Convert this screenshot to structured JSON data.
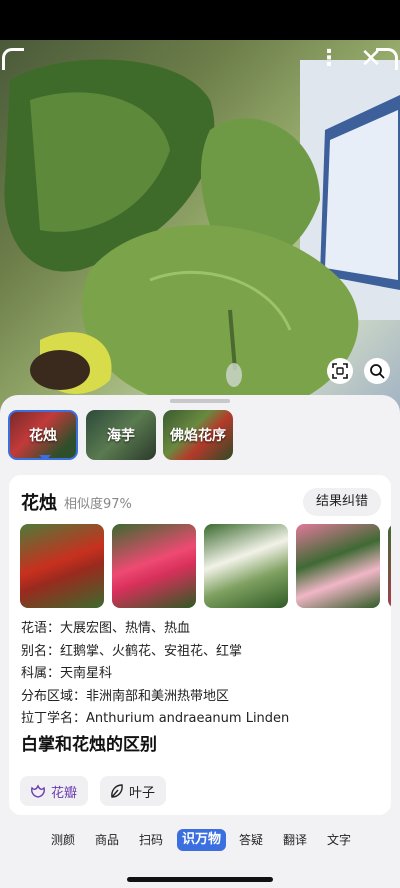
{
  "overlay": {
    "more_icon": "more-vertical-icon",
    "close_icon": "close-icon",
    "scan_icon": "scan-icon",
    "search_icon": "search-icon"
  },
  "candidates": [
    {
      "label": "花烛",
      "selected": true
    },
    {
      "label": "海芋",
      "selected": false
    },
    {
      "label": "佛焰花序",
      "selected": false
    }
  ],
  "result": {
    "name": "花烛",
    "similarity": "相似度97%",
    "correct_button": "结果纠错",
    "info": [
      {
        "text": "花语：大展宏图、热情、热血"
      },
      {
        "text": "别名：红鹅掌、火鹤花、安祖花、红掌"
      },
      {
        "text": "科属：天南星科"
      },
      {
        "text": "分布区域：非洲南部和美洲热带地区"
      },
      {
        "text": "拉丁学名：Anthurium andraeanum Linden"
      }
    ],
    "section_title": "白掌和花烛的区别",
    "compare_chips": [
      {
        "label": "花瓣",
        "icon": "petal-icon",
        "active": true
      },
      {
        "label": "叶子",
        "icon": "leaf-icon",
        "active": false
      }
    ]
  },
  "modes": [
    "测颜",
    "商品",
    "扫码",
    "识万物",
    "答疑",
    "翻译",
    "文字"
  ],
  "active_mode": "识万物",
  "colors": {
    "accent": "#3b6fe0",
    "petal_chip_text": "#6b3ab0"
  }
}
